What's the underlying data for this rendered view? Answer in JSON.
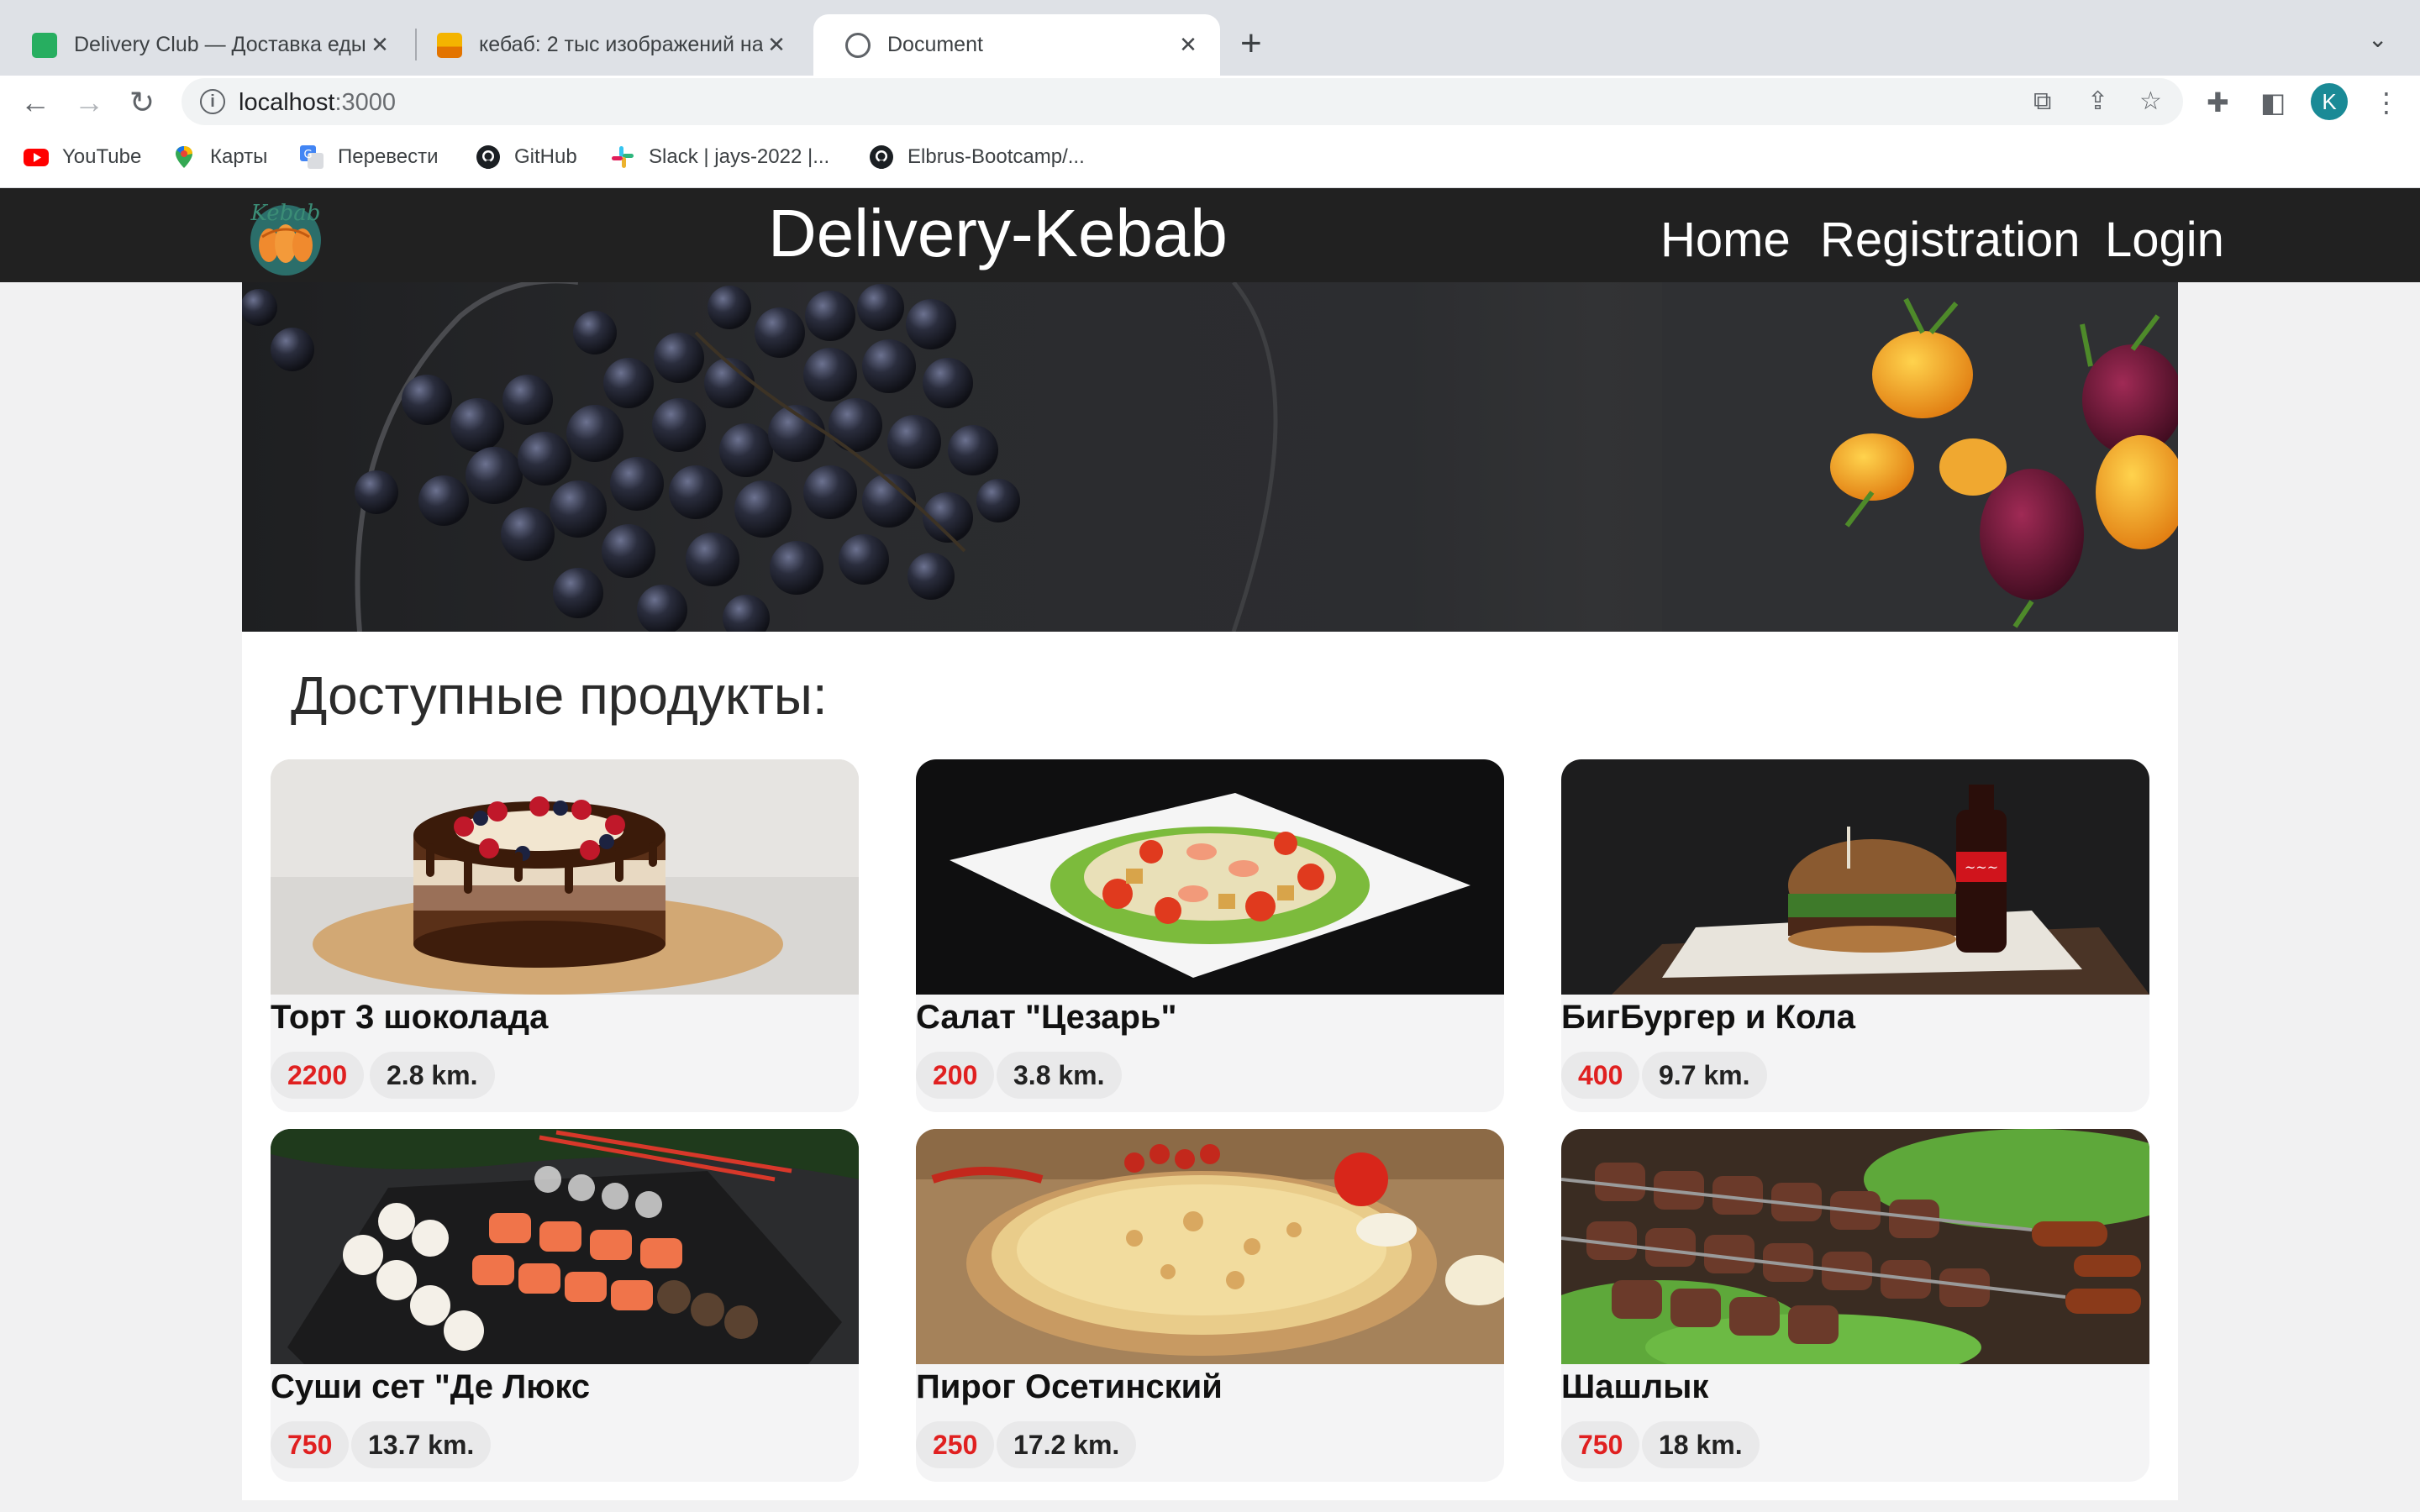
{
  "browser": {
    "tabs": [
      {
        "title": "Delivery Club — Доставка еды",
        "favicon_color": "#27ae60",
        "active": false
      },
      {
        "title": "кебаб: 2 тыс изображений на",
        "favicon_color": "#f4b400",
        "active": false
      },
      {
        "title": "Document",
        "favicon_color": "#5f6368",
        "active": true
      }
    ],
    "tab_close_glyph": "✕",
    "new_tab_glyph": "+",
    "tab_menu_glyph": "⌄",
    "url": {
      "host": "localhost",
      "port": ":3000"
    },
    "profile_initial": "K",
    "bookmarks": [
      {
        "label": "YouTube",
        "icon": "youtube-icon"
      },
      {
        "label": "Карты",
        "icon": "maps-icon"
      },
      {
        "label": "Перевести",
        "icon": "translate-icon"
      },
      {
        "label": "GitHub",
        "icon": "github-icon"
      },
      {
        "label": "Slack | jays-2022 |...",
        "icon": "slack-icon"
      },
      {
        "label": "Elbrus-Bootcamp/...",
        "icon": "github-icon"
      }
    ]
  },
  "site": {
    "logo_text": "Kebab",
    "title": "Delivery-Kebab",
    "nav": {
      "home": "Home",
      "registration": "Registration",
      "login": "Login"
    }
  },
  "section_title": "Доступные продукты:",
  "products": [
    {
      "name": "Торт 3 шоколада",
      "price": "2200",
      "distance": "2.8 km."
    },
    {
      "name": "Салат \"Цезарь\"",
      "price": "200",
      "distance": "3.8 km."
    },
    {
      "name": "БигБургер и Кола",
      "price": "400",
      "distance": "9.7 km."
    },
    {
      "name": "Суши сет \"Де Люкс",
      "price": "750",
      "distance": "13.7 km."
    },
    {
      "name": "Пирог Осетинский",
      "price": "250",
      "distance": "17.2 km."
    },
    {
      "name": "Шашлык",
      "price": "750",
      "distance": "18 km."
    }
  ],
  "colors": {
    "header_bg": "#212121",
    "price_red": "#e02020",
    "page_bg": "#f1f1f2"
  }
}
